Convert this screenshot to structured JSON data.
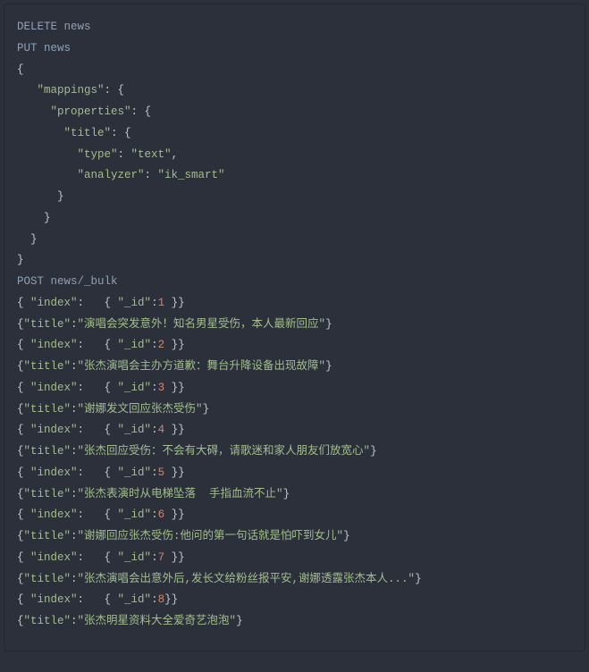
{
  "code": {
    "l1": {
      "a": "DELETE news"
    },
    "l2": {
      "a": "PUT news"
    },
    "l3": {
      "a": "{"
    },
    "l4": {
      "a": "   ",
      "b": "\"mappings\"",
      "c": ": {"
    },
    "l5": {
      "a": "     ",
      "b": "\"properties\"",
      "c": ": {"
    },
    "l6": {
      "a": "       ",
      "b": "\"title\"",
      "c": ": {"
    },
    "l7": {
      "a": "         ",
      "b": "\"type\"",
      "c": ": ",
      "d": "\"text\"",
      "e": ","
    },
    "l8": {
      "a": "         ",
      "b": "\"analyzer\"",
      "c": ": ",
      "d": "\"ik_smart\""
    },
    "l9": {
      "a": "      }"
    },
    "l10": {
      "a": "    }"
    },
    "l11": {
      "a": "  }"
    },
    "l12": {
      "a": "}"
    },
    "l13": {
      "a": ""
    },
    "l14": {
      "a": "POST news/_bulk"
    },
    "l15": {
      "a": "{ ",
      "b": "\"index\"",
      "c": ":   { ",
      "d": "\"_id\"",
      "e": ":",
      "f": "1",
      "g": " }}"
    },
    "l16": {
      "a": "{",
      "b": "\"title\"",
      "c": ":",
      "d": "\"演唱会突发意外！知名男星受伤，本人最新回应\"",
      "e": "}"
    },
    "l17": {
      "a": "{ ",
      "b": "\"index\"",
      "c": ":   { ",
      "d": "\"_id\"",
      "e": ":",
      "f": "2",
      "g": " }}"
    },
    "l18": {
      "a": "{",
      "b": "\"title\"",
      "c": ":",
      "d": "\"张杰演唱会主办方道歉：舞台升降设备出现故障\"",
      "e": "}"
    },
    "l19": {
      "a": "{ ",
      "b": "\"index\"",
      "c": ":   { ",
      "d": "\"_id\"",
      "e": ":",
      "f": "3",
      "g": " }}"
    },
    "l20": {
      "a": "{",
      "b": "\"title\"",
      "c": ":",
      "d": "\"谢娜发文回应张杰受伤\"",
      "e": "}"
    },
    "l21": {
      "a": "{ ",
      "b": "\"index\"",
      "c": ":   { ",
      "d": "\"_id\"",
      "e": ":",
      "f": "4",
      "g": " }}"
    },
    "l22": {
      "a": "{",
      "b": "\"title\"",
      "c": ":",
      "d": "\"张杰回应受伤：不会有大碍，请歌迷和家人朋友们放宽心\"",
      "e": "}"
    },
    "l23": {
      "a": "{ ",
      "b": "\"index\"",
      "c": ":   { ",
      "d": "\"_id\"",
      "e": ":",
      "f": "5",
      "g": " }}"
    },
    "l24": {
      "a": "{",
      "b": "\"title\"",
      "c": ":",
      "d": "\"张杰表演时从电梯坠落  手指血流不止\"",
      "e": "}"
    },
    "l25": {
      "a": "{ ",
      "b": "\"index\"",
      "c": ":   { ",
      "d": "\"_id\"",
      "e": ":",
      "f": "6",
      "g": " }}"
    },
    "l26": {
      "a": "{",
      "b": "\"title\"",
      "c": ":",
      "d": "\"谢娜回应张杰受伤:他问的第一句话就是怕吓到女儿\"",
      "e": "}"
    },
    "l27": {
      "a": "{ ",
      "b": "\"index\"",
      "c": ":   { ",
      "d": "\"_id\"",
      "e": ":",
      "f": "7",
      "g": " }}"
    },
    "l28": {
      "a": "{",
      "b": "\"title\"",
      "c": ":",
      "d": "\"张杰演唱会出意外后,发长文给粉丝报平安,谢娜透露张杰本人...\"",
      "e": "}"
    },
    "l29": {
      "a": "{ ",
      "b": "\"index\"",
      "c": ":   { ",
      "d": "\"_id\"",
      "e": ":",
      "f": "8",
      "g": "}}"
    },
    "l30": {
      "a": "{",
      "b": "\"title\"",
      "c": ":",
      "d": "\"张杰明星资料大全爱奇艺泡泡\"",
      "e": "}"
    }
  }
}
